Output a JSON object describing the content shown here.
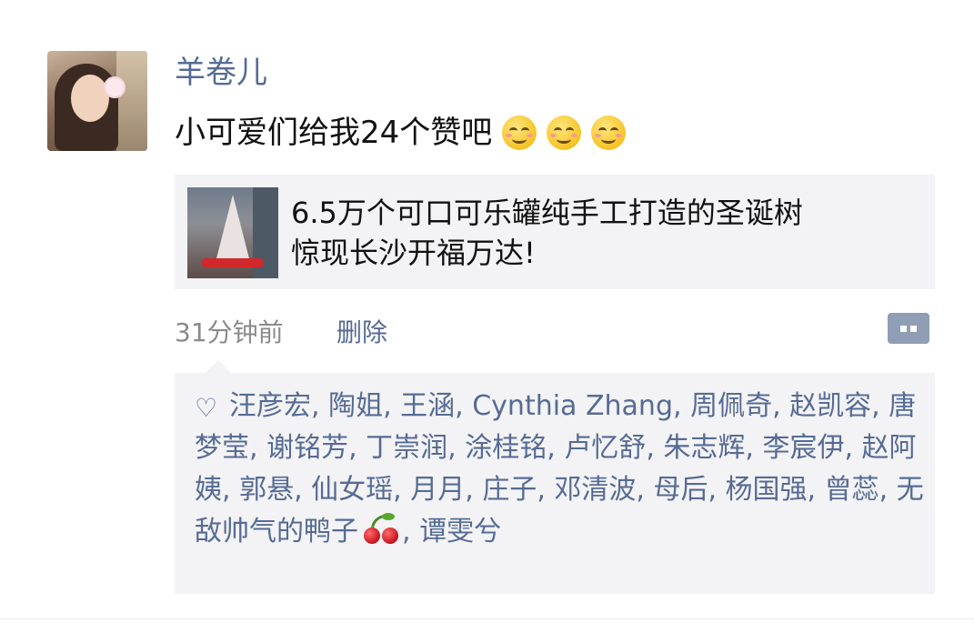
{
  "post": {
    "username": "羊卷儿",
    "text": "小可爱们给我24个赞吧",
    "emoji_icons": [
      "smiling-face-icon",
      "smiling-face-icon",
      "smiling-face-icon"
    ],
    "share_card": {
      "title_line1": "6.5万个可口可乐罐纯手工打造的圣诞树",
      "title_line2": "惊现长沙开福万达!"
    },
    "timestamp": "31分钟前",
    "delete_label": "删除"
  },
  "likes": {
    "names": [
      "汪彦宏",
      "陶姐",
      "王涵",
      "Cynthia Zhang",
      "周佩奇",
      "赵凯容",
      "唐梦莹",
      "谢铭芳",
      "丁崇润",
      "涂桂铭",
      "卢忆舒",
      "朱志辉",
      "李宸伊",
      "赵阿姨",
      "郭悬",
      "仙女瑶",
      "月月",
      "庄子",
      "邓清波",
      "母后",
      "杨国强",
      "曾蕊",
      "无敌帅气的鸭子",
      "谭雯兮"
    ],
    "separator": ", ",
    "heart_icon": "heart-outline-icon",
    "cherry_icon": "cherry-icon",
    "colors": {
      "name": "#566b94",
      "panel": "#f3f3f5"
    }
  }
}
